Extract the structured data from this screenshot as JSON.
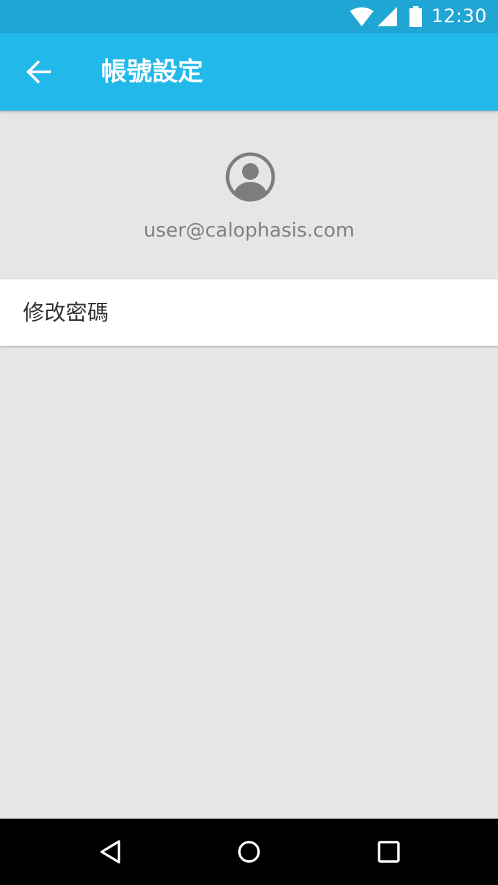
{
  "status_bar": {
    "time": "12:30",
    "icons": [
      "wifi-icon",
      "cell-signal-icon",
      "battery-icon"
    ]
  },
  "app_bar": {
    "title": "帳號設定",
    "back_icon": "arrow-left-icon",
    "color": "#22b8ea"
  },
  "profile": {
    "avatar_icon": "account-circle-icon",
    "email": "user@calophasis.com"
  },
  "settings": {
    "items": [
      {
        "label": "修改密碼"
      }
    ]
  },
  "nav_bar": {
    "buttons": [
      "nav-back-icon",
      "nav-home-icon",
      "nav-recents-icon"
    ]
  },
  "colors": {
    "status_bar": "#20a6d4",
    "app_bar": "#22b8ea",
    "background": "#e6e6e6",
    "secondary_text": "#808080"
  }
}
